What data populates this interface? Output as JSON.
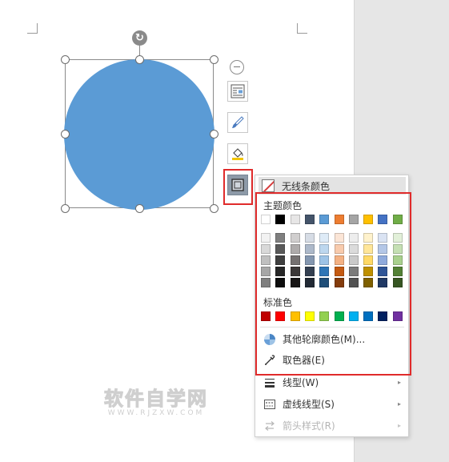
{
  "menu": {
    "no_line_label": "无线条颜色",
    "theme_title": "主题颜色",
    "standard_title": "标准色",
    "more_colors_label": "其他轮廓颜色(M)...",
    "eyedropper_label": "取色器(E)",
    "line_style_label": "线型(W)",
    "dash_style_label": "虚线线型(S)",
    "arrow_style_label": "箭头样式(R)",
    "theme_top_row": [
      "#ffffff",
      "#000000",
      "#e7e6e6",
      "#44546a",
      "#5b9bd5",
      "#ed7d31",
      "#a5a5a5",
      "#ffc000",
      "#4472c4",
      "#70ad47"
    ],
    "theme_shades": [
      [
        "#f2f2f2",
        "#7f7f7f",
        "#d0cece",
        "#d6dce5",
        "#deebf7",
        "#fbe5d6",
        "#ededed",
        "#fff2cc",
        "#dae3f3",
        "#e2f0d9"
      ],
      [
        "#d9d9d9",
        "#595959",
        "#aeabab",
        "#adb9ca",
        "#bdd7ee",
        "#f8cbad",
        "#dbdbdb",
        "#ffe699",
        "#b4c7e7",
        "#c5e0b4"
      ],
      [
        "#bfbfbf",
        "#3f3f3f",
        "#757171",
        "#8497b0",
        "#9dc3e6",
        "#f4b183",
        "#c9c9c9",
        "#ffd966",
        "#8faadc",
        "#a9d18e"
      ],
      [
        "#a6a6a6",
        "#262626",
        "#3b3838",
        "#333f50",
        "#2e75b6",
        "#c55a11",
        "#7b7b7b",
        "#bf9000",
        "#2f5597",
        "#538135"
      ],
      [
        "#7f7f7f",
        "#0d0d0d",
        "#171515",
        "#222a35",
        "#1f4e79",
        "#843c0c",
        "#525252",
        "#7f6000",
        "#203864",
        "#375623"
      ]
    ],
    "standard_colors": [
      "#c00000",
      "#ff0000",
      "#ffc000",
      "#ffff00",
      "#92d050",
      "#00b050",
      "#00b0f0",
      "#0070c0",
      "#002060",
      "#7030a0"
    ]
  },
  "shape": {
    "fill_color": "#5b9bd5"
  },
  "toolbar": {
    "icons": [
      "collapse-icon",
      "wrap-text-icon",
      "shape-style-brush-icon",
      "fill-bucket-icon",
      "outline-icon"
    ]
  },
  "watermark": {
    "cn": "软件自学网",
    "en": "WWW.RJZXW.COM"
  },
  "accent": {
    "highlight_red": "#e02b2b"
  }
}
